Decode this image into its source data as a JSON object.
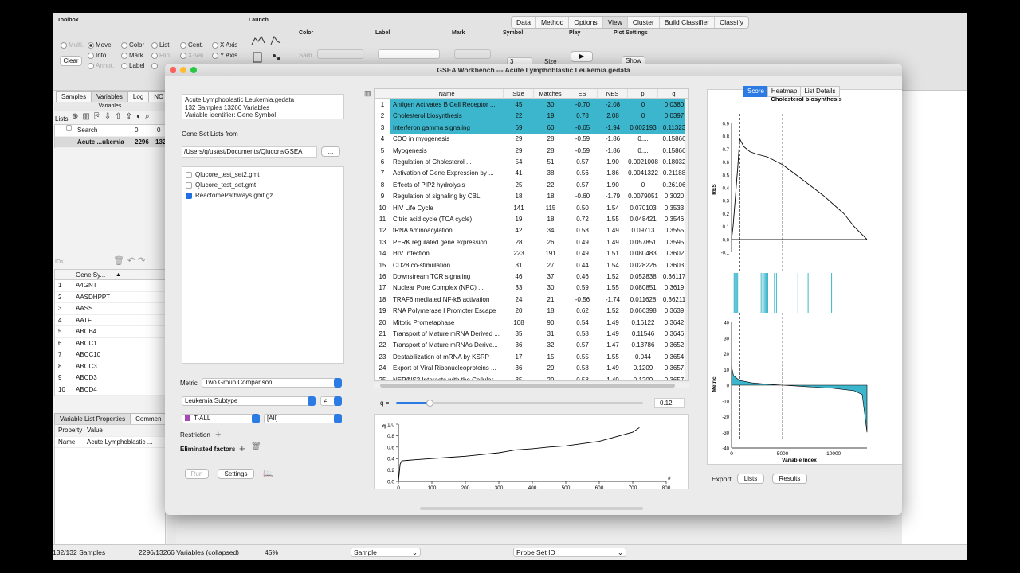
{
  "toolbar": {
    "toolbox_label": "Toolbox",
    "launch_label": "Launch",
    "menu_tabs": [
      "Data",
      "Method",
      "Options",
      "View",
      "Cluster",
      "Build Classifier",
      "Classify"
    ],
    "multi": "Multi.",
    "clear": "Clear",
    "move": "Move",
    "info": "Info",
    "annot": "Annot.",
    "color": "Color",
    "mark": "Mark",
    "label": "Label",
    "list": "List",
    "flip": "Flip",
    "cent": "Cent.",
    "xval": "X-Val.",
    "xaxis": "X Axis",
    "yaxis": "Y Axis",
    "color_group": "Color",
    "color_sel": "Sam.",
    "label_group": "Label",
    "mark_group": "Mark",
    "symbol_group": "Symbol",
    "symbol_value": "3",
    "size": "Size",
    "play_group": "Play",
    "plot_settings": "Plot Settings",
    "show": "Show"
  },
  "left": {
    "tabs": [
      "Samples",
      "Variables",
      "Log",
      "NC"
    ],
    "variables_header": "Variables",
    "lists_label": "Lists",
    "search_row": {
      "name": "Search",
      "a": "0",
      "b": "0"
    },
    "dataset_row": {
      "name": "Acute ...ukemia",
      "a": "2296",
      "b": "132"
    },
    "ids_label": "IDs",
    "gene_col": "Gene Sy...",
    "genes": [
      "A4GNT",
      "AASDHPPT",
      "AASS",
      "AATF",
      "ABCB4",
      "ABCC1",
      "ABCC10",
      "ABCC3",
      "ABCD3",
      "ABCD4"
    ],
    "prop_tabs": [
      "Variable List Properties",
      "Commen"
    ],
    "prop_header": [
      "Property",
      "Value"
    ],
    "prop_row": [
      "Name",
      "Acute Lymphoblastic ..."
    ]
  },
  "status": {
    "samples": "132/132 Samples",
    "variables": "2296/13266 Variables (collapsed)",
    "zoom": "45%",
    "sample_sel": "Sample",
    "probe_sel": "Probe Set ID"
  },
  "gsea": {
    "title": "GSEA Workbench --- Acute Lymphoblastic Leukemia.gedata",
    "info_lines": [
      "Acute Lymphoblastic Leukemia.gedata",
      "132 Samples 13266 Variables",
      "Variable identifier: Gene Symbol"
    ],
    "gene_set_lists_from": "Gene Set Lists from",
    "path": "/Users/q/usast/Documents/Qlucore/GSEA",
    "browse": "...",
    "files": [
      {
        "name": "Qlucore_test_set2.gmt",
        "checked": false
      },
      {
        "name": "Qlucore_test_set.gmt",
        "checked": false
      },
      {
        "name": "ReactomePathways.gmt.gz",
        "checked": true
      }
    ],
    "metric_label": "Metric",
    "metric_value": "Two Group Comparison",
    "subtype": "Leukemia Subtype",
    "neq": "≠",
    "group_a": "T-ALL",
    "group_b": "[All]",
    "restriction": "Restriction",
    "eliminated": "Eliminated factors",
    "run": "Run",
    "settings": "Settings",
    "q_label": "q =",
    "q_value": "0.12",
    "columns": [
      "Name",
      "Size",
      "Matches",
      "ES",
      "NES",
      "p",
      "q"
    ],
    "rows": [
      [
        "1",
        "Antigen Activates B Cell Receptor ...",
        "45",
        "30",
        "-0.70",
        "-2.08",
        "0",
        "0.0380"
      ],
      [
        "2",
        "Cholesterol biosynthesis",
        "22",
        "19",
        "0.78",
        "2.08",
        "0",
        "0.0397"
      ],
      [
        "3",
        "Interferon gamma signaling",
        "69",
        "60",
        "-0.65",
        "-1.94",
        "0.002193",
        "0.11323"
      ],
      [
        "4",
        "CDO in myogenesis",
        "29",
        "28",
        "-0.59",
        "-1.86",
        "0....",
        "0.15866"
      ],
      [
        "5",
        "Myogenesis",
        "29",
        "28",
        "-0.59",
        "-1.86",
        "0....",
        "0.15866"
      ],
      [
        "6",
        "Regulation of Cholesterol ...",
        "54",
        "51",
        "0.57",
        "1.90",
        "0.0021008",
        "0.18032"
      ],
      [
        "7",
        "Activation of Gene Expression by ...",
        "41",
        "38",
        "0.56",
        "1.86",
        "0.0041322",
        "0.21188"
      ],
      [
        "8",
        "Effects of PIP2 hydrolysis",
        "25",
        "22",
        "0.57",
        "1.90",
        "0",
        "0.26106"
      ],
      [
        "9",
        "Regulation of signaling by CBL",
        "18",
        "18",
        "-0.60",
        "-1.79",
        "0.0079051",
        "0.3020"
      ],
      [
        "10",
        "HIV Life Cycle",
        "141",
        "115",
        "0.50",
        "1.54",
        "0.070103",
        "0.3533"
      ],
      [
        "11",
        "Citric acid cycle (TCA cycle)",
        "19",
        "18",
        "0.72",
        "1.55",
        "0.048421",
        "0.3546"
      ],
      [
        "12",
        "tRNA Aminoacylation",
        "42",
        "34",
        "0.58",
        "1.49",
        "0.09713",
        "0.3555"
      ],
      [
        "13",
        "PERK regulated gene expression",
        "28",
        "26",
        "0.49",
        "1.49",
        "0.057851",
        "0.3595"
      ],
      [
        "14",
        "HIV Infection",
        "223",
        "191",
        "0.49",
        "1.51",
        "0.080483",
        "0.3602"
      ],
      [
        "15",
        "CD28 co-stimulation",
        "31",
        "27",
        "0.44",
        "1.54",
        "0.028226",
        "0.3603"
      ],
      [
        "16",
        "Downstream TCR signaling",
        "46",
        "37",
        "0.46",
        "1.52",
        "0.052838",
        "0.36117"
      ],
      [
        "17",
        "Nuclear Pore Complex (NPC) ...",
        "33",
        "30",
        "0.59",
        "1.55",
        "0.080851",
        "0.3619"
      ],
      [
        "18",
        "TRAF6 mediated NF-kB activation",
        "24",
        "21",
        "-0.56",
        "-1.74",
        "0.011628",
        "0.36211"
      ],
      [
        "19",
        "RNA Polymerase I Promoter Escape",
        "20",
        "18",
        "0.62",
        "1.52",
        "0.066398",
        "0.3639"
      ],
      [
        "20",
        "Mitotic Prometaphase",
        "108",
        "90",
        "0.54",
        "1.49",
        "0.16122",
        "0.3642"
      ],
      [
        "21",
        "Transport of Mature mRNA Derived ...",
        "35",
        "31",
        "0.58",
        "1.49",
        "0.11546",
        "0.3646"
      ],
      [
        "22",
        "Transport of Mature mRNAs Derive...",
        "36",
        "32",
        "0.57",
        "1.47",
        "0.13786",
        "0.3652"
      ],
      [
        "23",
        "Destabilization of mRNA by KSRP",
        "17",
        "15",
        "0.55",
        "1.55",
        "0.044",
        "0.3654"
      ],
      [
        "24",
        "Export of Viral Ribonucleoproteins ...",
        "36",
        "29",
        "0.58",
        "1.49",
        "0.1209",
        "0.3657"
      ],
      [
        "25",
        "NEP/NS2 Interacts with the Cellular ...",
        "35",
        "29",
        "0.58",
        "1.49",
        "0.1209",
        "0.3657"
      ]
    ],
    "right_tabs": [
      "Score",
      "Heatmap",
      "List Details"
    ],
    "score_title": "Cholesterol biosynthesis",
    "res_label": "RES",
    "metric_axis": "Metric",
    "xlabel": "Variable Index",
    "export": "Export",
    "lists_btn": "Lists",
    "results_btn": "Results",
    "qplot_ylabel": "q",
    "qplot_xlabel": "#"
  },
  "chart_data": [
    {
      "type": "line",
      "title": "",
      "xlabel": "#",
      "ylabel": "q",
      "xlim": [
        0,
        800
      ],
      "ylim": [
        0,
        1.0
      ],
      "xticks": [
        0,
        100,
        200,
        300,
        400,
        500,
        600,
        700,
        800
      ],
      "yticks": [
        0.0,
        0.2,
        0.4,
        0.6,
        0.8,
        1.0
      ],
      "x": [
        0,
        5,
        10,
        50,
        100,
        150,
        200,
        250,
        300,
        350,
        400,
        450,
        500,
        550,
        600,
        650,
        700,
        720
      ],
      "y": [
        0.0,
        0.3,
        0.36,
        0.38,
        0.4,
        0.42,
        0.44,
        0.47,
        0.5,
        0.55,
        0.57,
        0.6,
        0.62,
        0.66,
        0.7,
        0.78,
        0.86,
        0.94
      ]
    },
    {
      "type": "line",
      "title": "Cholesterol biosynthesis",
      "xlabel": "",
      "ylabel": "RES",
      "ylim": [
        -0.1,
        0.9
      ],
      "yticks": [
        -0.1,
        0,
        0.1,
        0.2,
        0.3,
        0.4,
        0.5,
        0.6,
        0.7,
        0.8,
        0.9
      ],
      "x": [
        0,
        150,
        300,
        600,
        800,
        1200,
        1800,
        2500,
        3500,
        5000,
        7000,
        9000,
        11000,
        12000,
        13266
      ],
      "y": [
        0,
        0.1,
        0.25,
        0.55,
        0.78,
        0.72,
        0.68,
        0.66,
        0.64,
        0.58,
        0.46,
        0.34,
        0.2,
        0.1,
        0
      ]
    },
    {
      "type": "area",
      "title": "",
      "xlabel": "Variable Index",
      "ylabel": "Metric",
      "xlim": [
        0,
        13266
      ],
      "ylim": [
        -40,
        40
      ],
      "xticks": [
        0,
        5000,
        10000
      ],
      "yticks": [
        -40,
        -30,
        -20,
        -10,
        0,
        10,
        20,
        30,
        40
      ],
      "x": [
        0,
        200,
        800,
        2000,
        3500,
        5000,
        6500,
        8000,
        10000,
        12000,
        12800,
        13266
      ],
      "y": [
        12,
        6,
        3,
        1.5,
        0.6,
        0,
        -0.6,
        -1.2,
        -2,
        -3.5,
        -6,
        -30
      ]
    }
  ]
}
